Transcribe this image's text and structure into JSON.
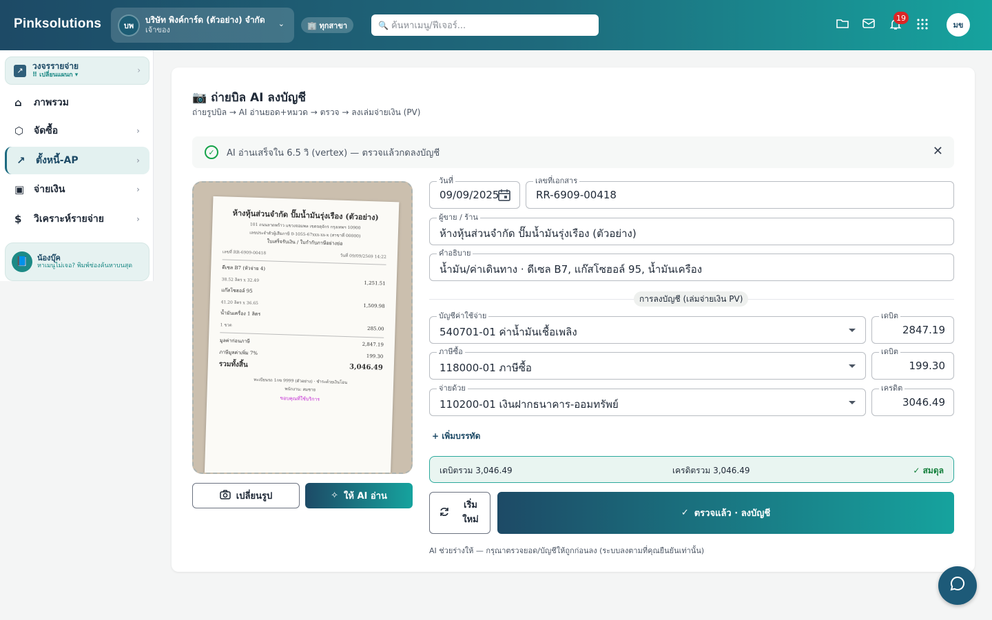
{
  "topbar": {
    "brand": "Pinksolutions",
    "company_avatar": "บพ",
    "company_name": "บริษัท พิงค์การ์ด (ตัวอย่าง) จำกัด",
    "company_role": "เจ้าของ",
    "branch": "🏢 ทุกสาขา",
    "search_placeholder": "ค้นหาเมนู/ฟีเจอร์...",
    "notification_count": "19",
    "user_avatar": "มข"
  },
  "sidebar": {
    "workspace_title": "วงจรรายจ่าย",
    "workspace_sub": "⠿ เปลี่ยนแผนก ▾",
    "items": [
      {
        "label": "ภาพรวม",
        "icon": "home-icon"
      },
      {
        "label": "จัดซื้อ",
        "icon": "box-icon"
      },
      {
        "label": "ตั้งหนี้-AP",
        "icon": "arrow-up-right-icon"
      },
      {
        "label": "จ่ายเงิน",
        "icon": "wallet-icon"
      },
      {
        "label": "วิเคราะห์รายจ่าย",
        "icon": "receipt-icon"
      }
    ],
    "helper_title": "น้องบุ๊ค",
    "helper_sub": "หาเมนูไม่เจอ? พิมพ์ช่องค้นหาบนสุด"
  },
  "page": {
    "title": "📷 ถ่ายบิล AI ลงบัญชี",
    "subtitle": "ถ่ายรูปบิล → AI อ่านยอด+หมวด → ตรวจ → ลงเล่มจ่ายเงิน (PV)",
    "alert": "AI อ่านเสร็จใน 6.5 วิ (vertex) — ตรวจแล้วกดลงบัญชี"
  },
  "receipt": {
    "shop": "ห้างหุ้นส่วนจำกัด ปั๊มน้ำมันรุ่งเรือง (ตัวอย่าง)",
    "address": "101 ถนนลาดพร้าว แขวงจอมพล เขตจตุจักร กรุงเทพฯ 10900",
    "taxid": "เลขประจำตัวผู้เสียภาษี 0-1055-67xxx-xx-x (สาขาที่ 00000)",
    "doc_type": "ใบเสร็จรับเงิน / ใบกำกับภาษีอย่างย่อ",
    "doc_no": "เลขที่ RR-6909-00418",
    "doc_date": "วันที่ 09/09/2569 14:22",
    "lines": [
      {
        "name": "ดีเซล B7 (หัวจ่าย 4)",
        "detail": "38.52 ลิตร x 32.49",
        "amount": "1,251.51"
      },
      {
        "name": "แก๊สโซฮอล์ 95",
        "detail": "41.20 ลิตร x 36.65",
        "amount": "1,509.98"
      },
      {
        "name": "น้ำมันเครื่อง 1 ลิตร",
        "detail": "1 ขวด",
        "amount": "285.00"
      }
    ],
    "pretax_label": "มูลค่าก่อนภาษี",
    "pretax": "2,847.19",
    "vat_label": "ภาษีมูลค่าเพิ่ม 7%",
    "vat": "199.30",
    "total_label": "รวมทั้งสิ้น",
    "total": "3,046.49",
    "footer": "ทะเบียนรถ 1กข 9999 (ตัวอย่าง) · ชำระด้วยเงินโอน",
    "cashier": "พนักงาน: สมชาย",
    "thanks": "ขอบคุณที่ใช้บริการ"
  },
  "buttons": {
    "change_image": "เปลี่ยนรูป",
    "ai_read": "ให้ AI อ่าน",
    "add_line": "+ เพิ่มบรรทัด",
    "reset": "เริ่มใหม่",
    "post": "ตรวจแล้ว · ลงบัญชี"
  },
  "form": {
    "date_label": "วันที่",
    "date_value": "09/09/2025",
    "docno_label": "เลขที่เอกสาร",
    "docno_value": "RR-6909-00418",
    "vendor_label": "ผู้ขาย / ร้าน",
    "vendor_value": "ห้างหุ้นส่วนจำกัด ปั๊มน้ำมันรุ่งเรือง (ตัวอย่าง)",
    "desc_label": "คำอธิบาย",
    "desc_value": "น้ำมัน/ค่าเดินทาง · ดีเซล B7, แก๊สโซฮอล์ 95, น้ำมันเครือง",
    "section_label": "การลงบัญชี (เล่มจ่ายเงิน PV)"
  },
  "entries": [
    {
      "label": "บัญชีค่าใช้จ่าย",
      "account": "540701-01 ค่าน้ำมันเชื้อเพลิง",
      "side": "เดบิต",
      "amount": "2847.19"
    },
    {
      "label": "ภาษีซื้อ",
      "account": "118000-01 ภาษีซื้อ",
      "side": "เดบิต",
      "amount": "199.30"
    },
    {
      "label": "จ่ายด้วย",
      "account": "110200-01 เงินฝากธนาคาร-ออมทรัพย์",
      "side": "เครดิต",
      "amount": "3046.49"
    }
  ],
  "balance": {
    "debit": "เดบิตรวม 3,046.49",
    "credit": "เครดิตรวม 3,046.49",
    "status": "✓ สมดุล"
  },
  "note": "AI ช่วยร่างให้ — กรุณาตรวจยอด/บัญชีให้ถูกก่อนลง (ระบบลงตามที่คุณยืนยันเท่านั้น)",
  "colors": {
    "brand_dark": "#1d4a66",
    "brand_teal": "#16a39e",
    "success": "#15803d",
    "badge": "#dc2626"
  }
}
